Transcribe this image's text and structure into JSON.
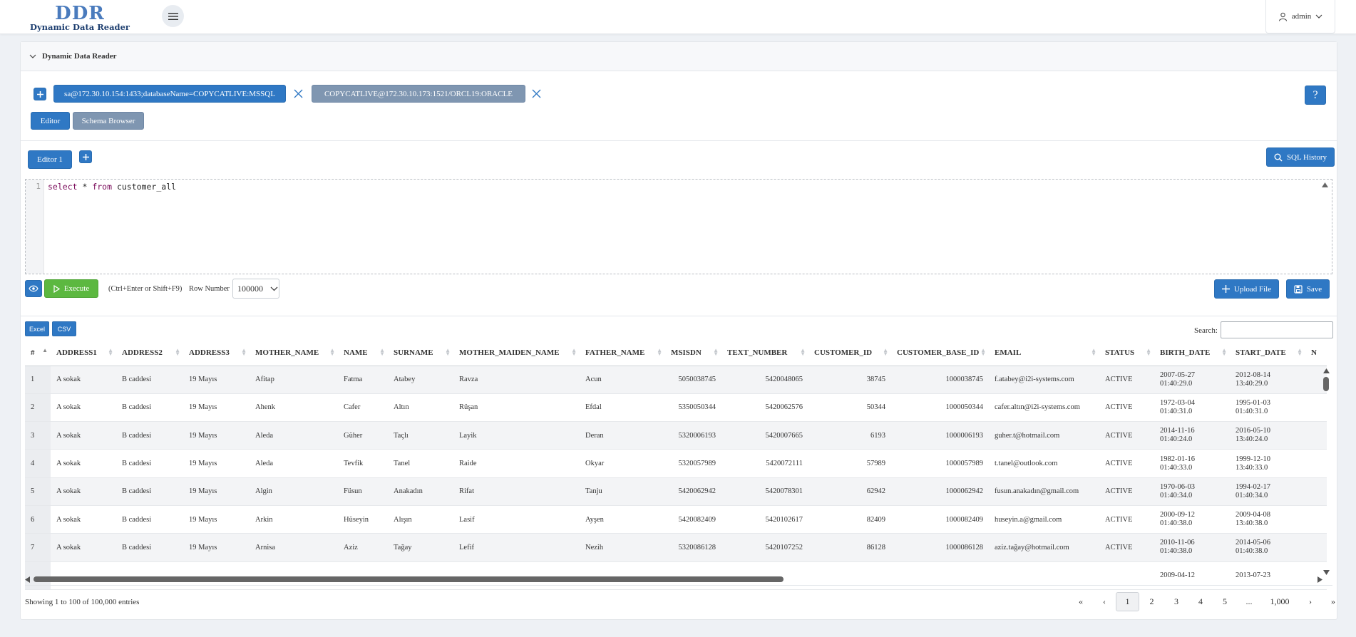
{
  "header": {
    "logo_main": "DDR",
    "logo_sub": "Dynamic Data Reader",
    "user_name": "admin"
  },
  "panel": {
    "title": "Dynamic Data Reader"
  },
  "connections": [
    {
      "label": "sa@172.30.10.154:1433;databaseName=COPYCATLIVE:MSSQL",
      "active": true
    },
    {
      "label": "COPYCATLIVE@172.30.10.173:1521/ORCL19:ORACLE",
      "active": false
    }
  ],
  "view_tabs": {
    "editor": "Editor",
    "schema_browser": "Schema Browser"
  },
  "editor_tab": "Editor 1",
  "sql_history_label": "SQL History",
  "editor": {
    "line_number": "1",
    "kw1": "select",
    "part2": " * ",
    "kw2": "from",
    "part3": " customer_all"
  },
  "toolbar": {
    "execute_label": "Execute",
    "shortcut_hint": "(Ctrl+Enter or Shift+F9)",
    "row_number_label": "Row Number",
    "row_number_value": "100000",
    "upload_label": "Upload File",
    "save_label": "Save"
  },
  "export": {
    "excel": "Excel",
    "csv": "CSV",
    "search_label": "Search:"
  },
  "table": {
    "columns": [
      "#",
      "ADDRESS1",
      "ADDRESS2",
      "ADDRESS3",
      "MOTHER_NAME",
      "NAME",
      "SURNAME",
      "MOTHER_MAIDEN_NAME",
      "FATHER_NAME",
      "MSISDN",
      "TEXT_NUMBER",
      "CUSTOMER_ID",
      "CUSTOMER_BASE_ID",
      "EMAIL",
      "STATUS",
      "BIRTH_DATE",
      "START_DATE",
      "N"
    ],
    "rows": [
      [
        "1",
        "A sokak",
        "B caddesi",
        "19 Mayıs",
        "Afitap",
        "Fatma",
        "Atabey",
        "Ravza",
        "Acun",
        "5050038745",
        "5420048065",
        "38745",
        "1000038745",
        "f.atabey@i2i-systems.com",
        "ACTIVE",
        "2007-05-27",
        "01:40:29.0",
        "2012-08-14",
        "13:40:29.0"
      ],
      [
        "2",
        "A sokak",
        "B caddesi",
        "19 Mayıs",
        "Ahenk",
        "Cafer",
        "Altın",
        "Rüşan",
        "Efdal",
        "5350050344",
        "5420062576",
        "50344",
        "1000050344",
        "cafer.altın@i2i-systems.com",
        "ACTIVE",
        "1972-03-04",
        "01:40:31.0",
        "1995-01-03",
        "01:40:31.0"
      ],
      [
        "3",
        "A sokak",
        "B caddesi",
        "19 Mayıs",
        "Aleda",
        "Güher",
        "Taçlı",
        "Layik",
        "Deran",
        "5320006193",
        "5420007665",
        "6193",
        "1000006193",
        "guher.t@hotmail.com",
        "ACTIVE",
        "2014-11-16",
        "01:40:24.0",
        "2016-05-10",
        "13:40:24.0"
      ],
      [
        "4",
        "A sokak",
        "B caddesi",
        "19 Mayıs",
        "Aleda",
        "Tevfik",
        "Tanel",
        "Raide",
        "Okyar",
        "5320057989",
        "5420072111",
        "57989",
        "1000057989",
        "t.tanel@outlook.com",
        "ACTIVE",
        "1982-01-16",
        "01:40:33.0",
        "1999-12-10",
        "13:40:33.0"
      ],
      [
        "5",
        "A sokak",
        "B caddesi",
        "19 Mayıs",
        "Algin",
        "Füsun",
        "Anakadın",
        "Rifat",
        "Tanju",
        "5420062942",
        "5420078301",
        "62942",
        "1000062942",
        "fusun.anakadın@gmail.com",
        "ACTIVE",
        "1970-06-03",
        "01:40:34.0",
        "1994-02-17",
        "01:40:34.0"
      ],
      [
        "6",
        "A sokak",
        "B caddesi",
        "19 Mayıs",
        "Arkin",
        "Hüseyin",
        "Alışın",
        "Lasif",
        "Ayşen",
        "5420082409",
        "5420102617",
        "82409",
        "1000082409",
        "huseyin.a@gmail.com",
        "ACTIVE",
        "2000-09-12",
        "01:40:38.0",
        "2009-04-08",
        "13:40:38.0"
      ],
      [
        "7",
        "A sokak",
        "B caddesi",
        "19 Mayıs",
        "Arnisa",
        "Aziz",
        "Tağay",
        "Lefif",
        "Nezih",
        "5320086128",
        "5420107252",
        "86128",
        "1000086128",
        "aziz.tağay@hotmail.com",
        "ACTIVE",
        "2010-11-06",
        "01:40:38.0",
        "2014-05-06",
        "01:40:38.0"
      ],
      [
        "",
        "",
        "",
        "",
        "",
        "",
        "",
        "",
        "",
        "",
        "",
        "",
        "",
        "",
        "",
        "2009-04-12",
        "",
        "2013-07-23",
        ""
      ]
    ]
  },
  "footer": {
    "info": "Showing 1 to 100 of 100,000 entries",
    "pages": [
      "«",
      "‹",
      "1",
      "2",
      "3",
      "4",
      "5",
      "...",
      "1,000",
      "›",
      "»"
    ],
    "current_page": "1"
  },
  "colors": {
    "primary": "#2f78c4",
    "secondary": "#7f96b1",
    "success": "#5cb840"
  }
}
